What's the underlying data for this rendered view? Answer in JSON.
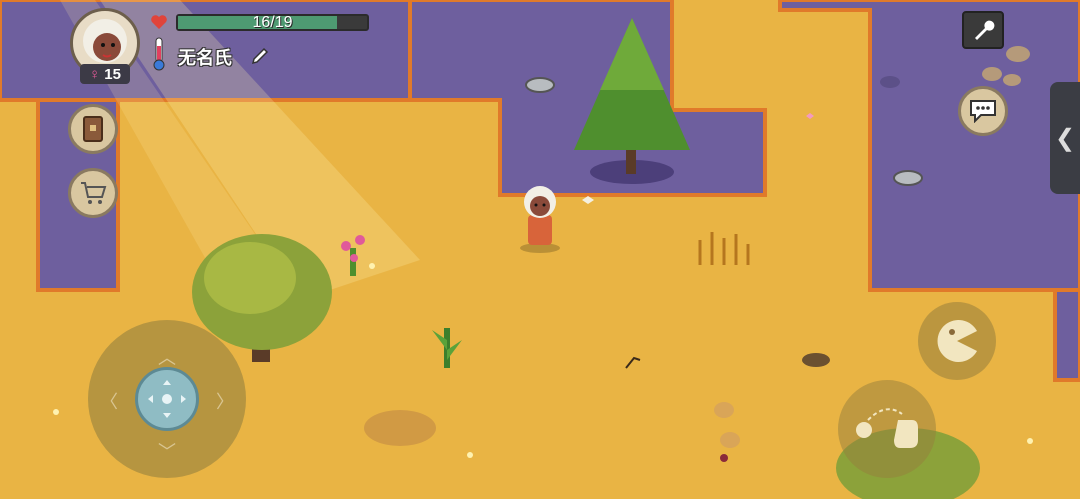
{
  "player": {
    "name": "无名氏",
    "age": "15",
    "gender_symbol": "♀",
    "health_text": "16/19",
    "health_fraction": 0.842
  },
  "icons": {
    "heart": "heart-icon",
    "thermometer": "thermometer-icon",
    "edit": "pencil-icon",
    "settings": "wrench-icon",
    "chat": "speech-bubble-icon",
    "journal": "book-icon",
    "shop": "cart-icon",
    "eat": "pacman-eat-icon",
    "throw": "throw-hand-icon",
    "side_tab": "chevron-left-icon"
  },
  "side_tab_glyph": "❮",
  "joystick_arrows": {
    "up": "︿",
    "down": "﹀",
    "left": "〈",
    "right": "〉"
  },
  "colors": {
    "sand": "#e9b444",
    "water": "#6e5f9e",
    "shore": "#e07a2a",
    "health": "#4e9a72"
  }
}
